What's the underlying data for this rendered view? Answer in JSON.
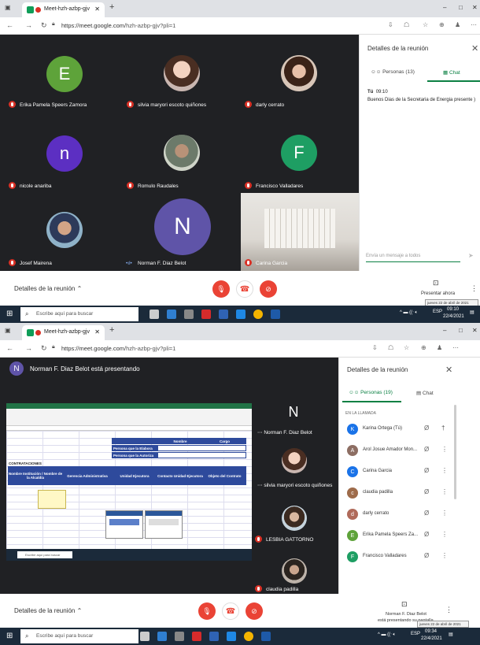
{
  "screen1": {
    "tab": {
      "title": "Meet-hzh-azbp-gjv"
    },
    "url": {
      "host": "https://meet.google.com",
      "path": "/hzh-azbp-gjv?pli=1"
    },
    "participants": [
      {
        "name": "Erika Pamela Speers Zamora",
        "initial": "E",
        "color": "#5ea33a"
      },
      {
        "name": "silvia maryori escoto quiñones"
      },
      {
        "name": "darly cerrato"
      },
      {
        "name": "nicole anariba",
        "initial": "n",
        "color": "#5c2fc2"
      },
      {
        "name": "Romulo Raudales"
      },
      {
        "name": "Francisco Valladares",
        "initial": "F",
        "color": "#1e9e63"
      },
      {
        "name": "Josef Mairena"
      },
      {
        "name": "Norman F. Diaz Belot",
        "initial": "N",
        "color": "#5f54a8"
      },
      {
        "name": "Carina Garcia"
      }
    ],
    "panel": {
      "title": "Detalles de la reunión",
      "people_tab": "Personas (13)",
      "chat_tab": "Chat",
      "message_sender": "Tú",
      "message_time": "09:10",
      "message_text": "Buenos Dias de la Secretaria de Energia presente )",
      "input_placeholder": "Envía un mensaje a todos"
    },
    "bottom": {
      "details_label": "Detalles de la reunión",
      "present_label": "Presentar ahora",
      "date_tooltip": "jueves 22 de abril de 2021"
    },
    "taskbar": {
      "search_placeholder": "Escribe aquí para buscar",
      "time": "09:10",
      "date": "22/4/2021",
      "lang": "ESP"
    }
  },
  "screen2": {
    "tab": {
      "title": "Meet-hzh-azbp-gjv"
    },
    "url": {
      "host": "https://meet.google.com",
      "path": "/hzh-azbp-gjv?pli=1"
    },
    "presenter_banner": "Norman F. Diaz Belot está presentando",
    "presenter_initial": "N",
    "sheet": {
      "header_nombre": "Nombre",
      "header_cargo": "Cargo",
      "row1": "Persona que la Elabora",
      "row2": "Persona que la Autoriza",
      "section": "CONTRATACIONES",
      "col1": "Nombre Institución / Nombre de la Alcaldía",
      "col2": "Gerencia Administrativa",
      "col3": "Unidad Ejecutora",
      "col4": "Contacto Unidad Ejecutora",
      "col5": "Objeto del Contrato",
      "tb_search": "Escribe aquí para buscar"
    },
    "side_tiles": [
      {
        "name": "Norman F. Diaz Belot",
        "initial": "N",
        "color": "#5f54a8"
      },
      {
        "name": "silvia maryori escoto quiñones"
      },
      {
        "name": "LESBIA GATTORNO"
      },
      {
        "name": "claudia padilla"
      }
    ],
    "panel": {
      "title": "Detalles de la reunión",
      "people_tab": "Personas (19)",
      "chat_tab": "Chat",
      "section_label": "EN LA LLAMADA",
      "people": [
        {
          "name": "Karina Ortega (Tú)",
          "initial": "K",
          "color": "#1a73e8"
        },
        {
          "name": "Arol Josue Amador Mon...",
          "initial": "A",
          "color": "#8d6e63"
        },
        {
          "name": "Carina Garcia",
          "initial": "C",
          "color": "#1a73e8"
        },
        {
          "name": "claudia padilla",
          "initial": "c",
          "color": "#9e6b4a"
        },
        {
          "name": "darly cerrato",
          "initial": "d",
          "color": "#b06a5a"
        },
        {
          "name": "Erika Pamela Speers Za...",
          "initial": "E",
          "color": "#5ea33a"
        },
        {
          "name": "Francisco Valladares",
          "initial": "F",
          "color": "#1e9e63"
        }
      ]
    },
    "bottom": {
      "details_label": "Detalles de la reunión",
      "present_label1": "Norman F. Diaz Belot",
      "present_label2": "está presentando su pantalla",
      "date_tooltip": "jueves 22 de abril de 2021"
    },
    "taskbar": {
      "search_placeholder": "Escribe aquí para buscar",
      "time": "09:34",
      "date": "22/4/2021",
      "lang": "ESP"
    }
  }
}
